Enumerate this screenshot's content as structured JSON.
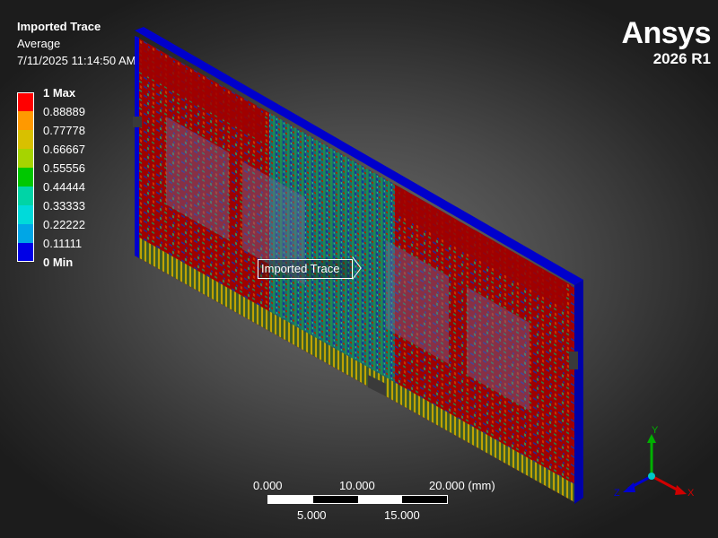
{
  "header": {
    "title": "Imported Trace",
    "subtitle": "Average",
    "timestamp": "7/11/2025 11:14:50 AM"
  },
  "legend": {
    "items": [
      {
        "label": "1 Max",
        "color": "#ff0000",
        "strong": true
      },
      {
        "label": "0.88889",
        "color": "#ff9900"
      },
      {
        "label": "0.77778",
        "color": "#d8c000"
      },
      {
        "label": "0.66667",
        "color": "#a6d400"
      },
      {
        "label": "0.55556",
        "color": "#00c800"
      },
      {
        "label": "0.44444",
        "color": "#00d4a6"
      },
      {
        "label": "0.33333",
        "color": "#00dada"
      },
      {
        "label": "0.22222",
        "color": "#00a6e6"
      },
      {
        "label": "0.11111",
        "color": "#0000e6"
      }
    ],
    "min_label": "0 Min"
  },
  "brand": {
    "name": "Ansys",
    "version": "2026 R1"
  },
  "callout": {
    "label": "Imported Trace"
  },
  "scale": {
    "top_labels": [
      "0.000",
      "10.000",
      "20.000 (mm)"
    ],
    "bottom_labels": [
      "5.000",
      "15.000"
    ]
  },
  "triad": {
    "x": "X",
    "y": "Y",
    "z": "Z"
  },
  "colors": {
    "board_base": "#a00000",
    "board_edge": "#0000cc",
    "trace_green": "#1e8a52",
    "trace_blue": "#1a2f9e",
    "contact_gold": "#c8a800"
  }
}
